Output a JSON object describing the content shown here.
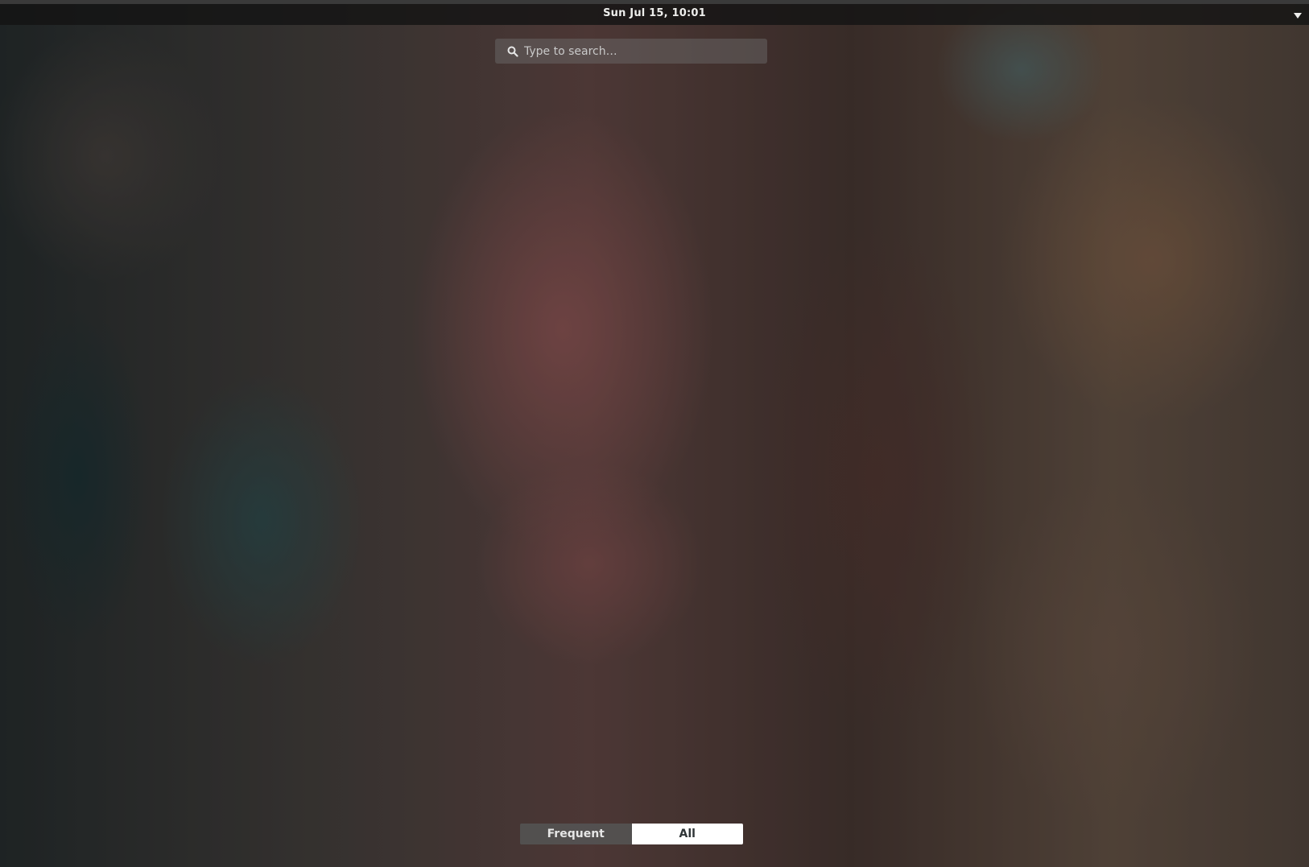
{
  "top_bar": {
    "clock": "Sun Jul 15, 10:01",
    "system_menu_icon": "triangle-down-icon"
  },
  "search": {
    "placeholder": "Type to search…",
    "value": "",
    "icon": "search-icon"
  },
  "view_switcher": {
    "tabs": [
      {
        "label": "Frequent",
        "selected": false
      },
      {
        "label": "All",
        "selected": true
      }
    ]
  },
  "colors": {
    "top_bar_bg": "#141414",
    "clock_text": "#eeeeec",
    "selected_tab_bg": "#ffffff",
    "unselected_tab_bg": "#555555"
  }
}
